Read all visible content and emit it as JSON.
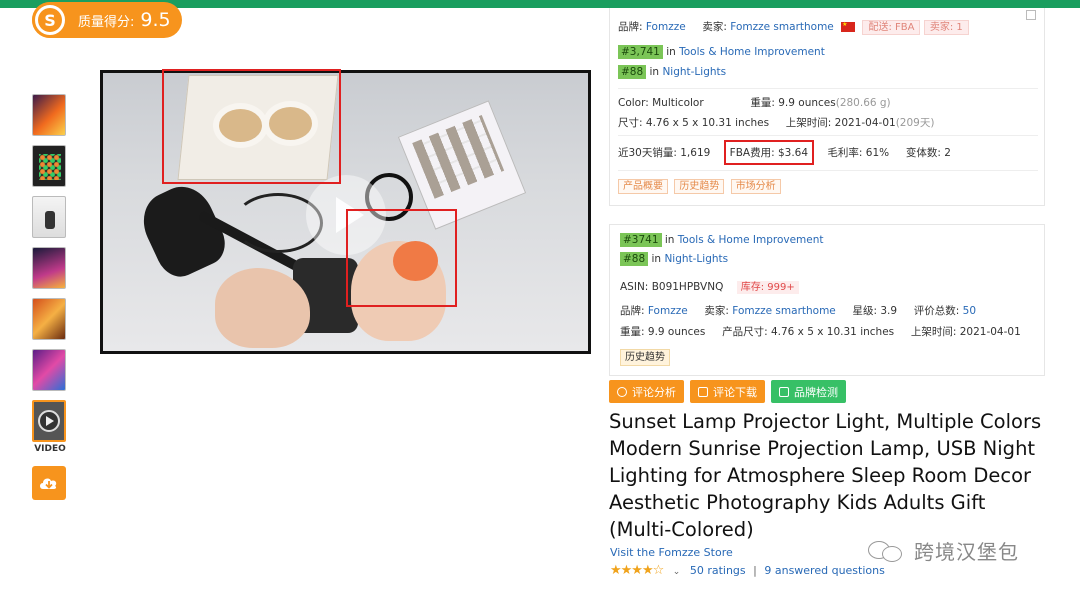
{
  "score": {
    "label": "质量得分:",
    "value": "9.5",
    "logo_letter": "S"
  },
  "video_label": "VIDEO",
  "panel1": {
    "brand_label": "品牌:",
    "brand": "Fomzze",
    "seller_label": "卖家:",
    "seller": "Fomzze smarthome",
    "fulfillment": "配送: FBA",
    "seller_count": "卖家: 1",
    "rank1": "#3,741",
    "rank1_in": "in",
    "rank1_cat": "Tools & Home Improvement",
    "rank2": "#88",
    "rank2_in": "in",
    "rank2_cat": "Night-Lights",
    "color_label": "Color:",
    "color": "Multicolor",
    "weight_label": "重量:",
    "weight": "9.9 ounces",
    "weight_g": "(280.66 g)",
    "size_label": "尺寸:",
    "size": "4.76 x 5 x 10.31 inches",
    "listed_label": "上架时间:",
    "listed": "2021-04-01",
    "listed_days": "(209天)",
    "sales_label": "近30天销量:",
    "sales": "1,619",
    "fba_label": "FBA费用:",
    "fba": "$3.64",
    "margin_label": "毛利率:",
    "margin": "61%",
    "variants_label": "变体数:",
    "variants": "2",
    "tags": [
      "产品概要",
      "历史趋势",
      "市场分析"
    ]
  },
  "panel2": {
    "rank1": "#3741",
    "rank1_in": "in",
    "rank1_cat": "Tools & Home Improvement",
    "rank2": "#88",
    "rank2_in": "in",
    "rank2_cat": "Night-Lights",
    "asin_label": "ASIN:",
    "asin": "B091HPBVNQ",
    "stock": "库存: 999+",
    "brand_label": "品牌:",
    "brand": "Fomzze",
    "seller_label": "卖家:",
    "seller": "Fomzze smarthome",
    "stars_label": "星级:",
    "stars": "3.9",
    "reviews_label": "评价总数:",
    "reviews": "50",
    "weight_label": "重量:",
    "weight": "9.9 ounces",
    "size_label": "产品尺寸:",
    "size": "4.76 x 5 x 10.31 inches",
    "listed_label": "上架时间:",
    "listed": "2021-04-01",
    "history_tag": "历史趋势"
  },
  "buttons": {
    "review_analysis": "评论分析",
    "review_download": "评论下载",
    "brand_check": "品牌检测"
  },
  "product": {
    "title": "Sunset Lamp Projector Light, Multiple Colors Modern Sunrise Projection Lamp, USB Night Lighting for Atmosphere Sleep Room Decor Aesthetic Photography Kids Adults Gift (Multi-Colored)",
    "store": "Visit the Fomzze Store",
    "stars": "★★★★☆",
    "ratings": "50 ratings",
    "separator": "|",
    "answered": "9 answered questions"
  },
  "watermark": "跨境汉堡包",
  "colors": {
    "accent": "#f7941d",
    "green": "#37c066",
    "link": "#2869b6",
    "highlight": "#e02020"
  }
}
